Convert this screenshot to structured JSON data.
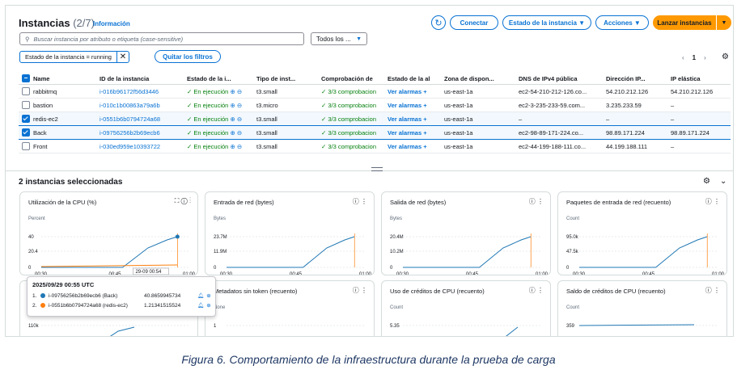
{
  "header": {
    "title": "Instancias",
    "count": "(2/7)",
    "info": "Información",
    "connect": "Conectar",
    "state_menu": "Estado de la instancia ▼",
    "actions_menu": "Acciones ▼",
    "launch": "Lanzar instancias",
    "launch_arrow": "▼"
  },
  "search": {
    "placeholder": "Buscar instancia por atributo o etiqueta (case-sensitive)",
    "filter_select": "Todos los ..."
  },
  "filter_chip": "Estado de la instancia = running",
  "clear_filters": "Quitar los filtros",
  "pager": {
    "page": "1"
  },
  "table": {
    "columns": [
      "Name",
      "ID de la instancia",
      "Estado de la i...",
      "Tipo de inst...",
      "Comprobación de",
      "Estado de la al",
      "Zona de dispon...",
      "DNS de IPv4 pública",
      "Dirección IP...",
      "IP elástica"
    ],
    "rows": [
      {
        "name": "rabbitmq",
        "id": "i-016b96172f56d3446",
        "state": "En ejecución",
        "type": "t3.small",
        "check": "3/3 comprobacion",
        "alarm": "Ver alarmas +",
        "zone": "us-east-1a",
        "dns": "ec2-54-210-212-126.co...",
        "ip": "54.210.212.126",
        "eip": "54.210.212.126",
        "selected": false
      },
      {
        "name": "bastion",
        "id": "i-010c1b00863a79a6b",
        "state": "En ejecución",
        "type": "t3.micro",
        "check": "3/3 comprobacion",
        "alarm": "Ver alarmas +",
        "zone": "us-east-1a",
        "dns": "ec2-3-235-233-59.com...",
        "ip": "3.235.233.59",
        "eip": "–",
        "selected": false
      },
      {
        "name": "redis-ec2",
        "id": "i-0551b6b0794724a68",
        "state": "En ejecución",
        "type": "t3.small",
        "check": "3/3 comprobacion",
        "alarm": "Ver alarmas +",
        "zone": "us-east-1a",
        "dns": "–",
        "ip": "–",
        "eip": "–",
        "selected": true
      },
      {
        "name": "Back",
        "id": "i-09756256b2b69ecb6",
        "state": "En ejecución",
        "type": "t3.small",
        "check": "3/3 comprobacion",
        "alarm": "Ver alarmas +",
        "zone": "us-east-1a",
        "dns": "ec2-98-89-171-224.co...",
        "ip": "98.89.171.224",
        "eip": "98.89.171.224",
        "selected": true
      },
      {
        "name": "Front",
        "id": "i-030ed959e10393722",
        "state": "En ejecución",
        "type": "t3.small",
        "check": "3/3 comprobacion",
        "alarm": "Ver alarmas +",
        "zone": "us-east-1a",
        "dns": "ec2-44-199-188-111.co...",
        "ip": "44.199.188.111",
        "eip": "–",
        "selected": false
      }
    ]
  },
  "monitoring": {
    "title": "2 instancias seleccionadas",
    "cards": [
      {
        "title": "Utilización de la CPU (%)",
        "unit": "Percent",
        "y_ticks": [
          "40",
          "20.4",
          "0"
        ],
        "x_ticks": [
          "00:30",
          "00:45",
          "01:00"
        ]
      },
      {
        "title": "Entrada de red (bytes)",
        "unit": "Bytes",
        "y_ticks": [
          "23.7M",
          "11.9M",
          "0"
        ],
        "x_ticks": [
          "00:30",
          "00:45",
          "01:00"
        ]
      },
      {
        "title": "Salida de red (bytes)",
        "unit": "Bytes",
        "y_ticks": [
          "20.4M",
          "10.2M",
          "0"
        ],
        "x_ticks": [
          "00:30",
          "00:45",
          "01:00"
        ]
      },
      {
        "title": "Paquetes de entrada de red (recuento)",
        "unit": "Count",
        "y_ticks": [
          "95.0k",
          "47.5k",
          "0"
        ],
        "x_ticks": [
          "00:30",
          "00:45",
          "01:00"
        ]
      },
      {
        "title": "",
        "unit": "Count",
        "y_ticks": [
          "110k",
          "55.0k"
        ],
        "x_ticks": []
      },
      {
        "title": "Metadatos sin token (recuento)",
        "unit": "None",
        "y_ticks": [
          "1",
          "0.5"
        ],
        "x_ticks": []
      },
      {
        "title": "Uso de créditos de CPU (recuento)",
        "unit": "Count",
        "y_ticks": [
          "5.35",
          "2.67"
        ],
        "x_ticks": []
      },
      {
        "title": "Saldo de créditos de CPU (recuento)",
        "unit": "Count",
        "y_ticks": [
          "359",
          "179"
        ],
        "x_ticks": []
      }
    ],
    "cursor_label": "29-09 00:54",
    "tooltip": {
      "time": "2025/09/29 00:55 UTC",
      "rows": [
        {
          "n": "1.",
          "id": "i-09756256b2b69ecb6 (Back)",
          "value": "40.8659945734",
          "color": "#1f77b4"
        },
        {
          "n": "2.",
          "id": "i-0551b6b0794724a68 (redis-ec2)",
          "value": "1.21341515524",
          "color": "#ff7f0e"
        }
      ]
    }
  },
  "caption": "Figura 6. Comportamiento de la infraestructura durante la prueba de carga"
}
